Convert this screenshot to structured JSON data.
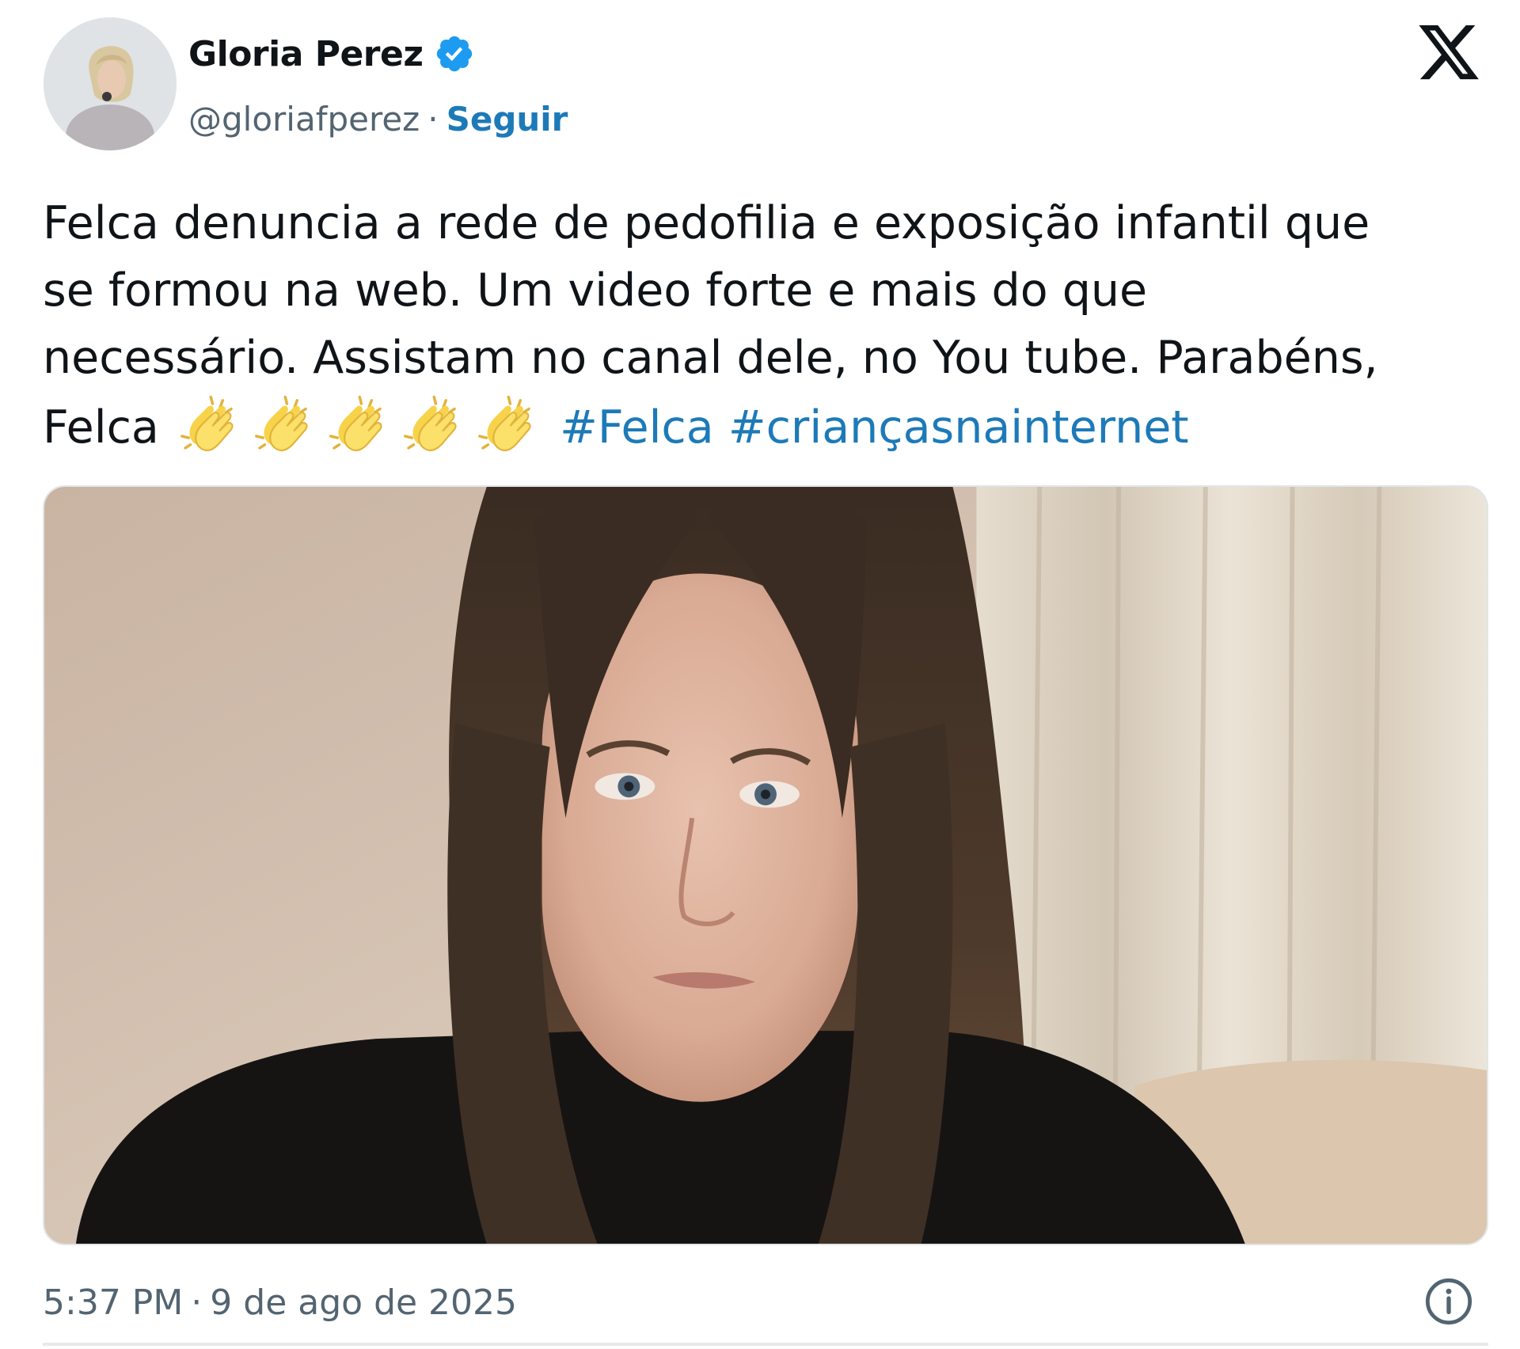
{
  "author": {
    "display_name": "Gloria Perez",
    "handle": "@gloriafperez",
    "separator": "·",
    "follow_label": "Seguir",
    "verified": true
  },
  "tweet": {
    "lines": [
      "Felca denuncia a rede de pedofilia e exposição infantil que",
      "se formou na web. Um video forte e mais do que",
      "necessário. Assistam no canal dele, no You tube. Parabéns,"
    ],
    "last_line_text": "Felca",
    "emoji": [
      "clapping-hands",
      "clapping-hands",
      "clapping-hands",
      "clapping-hands",
      "clapping-hands"
    ],
    "hashtags": [
      "#Felca",
      "#criançasnainternet"
    ]
  },
  "timestamp": {
    "time": "5:37 PM",
    "separator": "·",
    "date": "9 de ago de 2025"
  },
  "icons": {
    "brand": "x-logo-icon",
    "verified": "verified-badge-icon",
    "info": "info-icon"
  },
  "colors": {
    "link": "#1d7ab8",
    "verified": "#1d9bf0",
    "secondary_text": "#536471",
    "primary_text": "#0f1419"
  }
}
